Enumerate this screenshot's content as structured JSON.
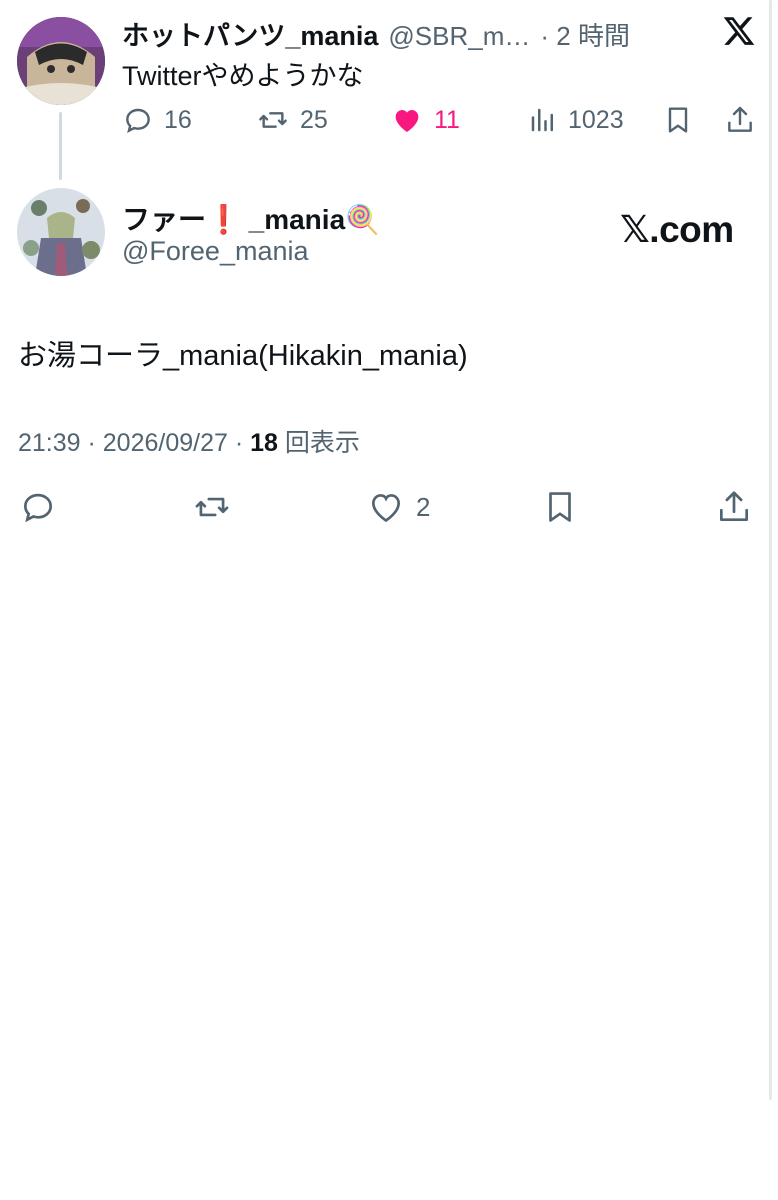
{
  "quoted_tweet": {
    "display_name": "ホットパンツ_mania",
    "handle": "@SBR_m…",
    "time": "· 2 時間",
    "text": "Twitterやめようかな",
    "stats": {
      "replies": "16",
      "retweets": "25",
      "likes": "11",
      "views": "1023"
    }
  },
  "main_tweet": {
    "display_name": "ファー❗ _mania🍭",
    "handle": "@Foree_mania",
    "brand": "𝕏.com",
    "text": "お湯コーラ_mania(Hikakin_mania)",
    "meta": {
      "time": "21:39 · 2026/09/27 · ",
      "views_count": "18",
      "views_label": " 回表示"
    },
    "stats": {
      "likes": "2"
    }
  },
  "colors": {
    "like_active": "#f91880",
    "muted": "#536471",
    "text": "#0f1419",
    "line": "#cfd9de"
  },
  "icons": [
    "x-logo-icon",
    "reply-icon",
    "retweet-icon",
    "heart-filled-icon",
    "views-icon",
    "bookmark-icon",
    "share-icon",
    "heart-outline-icon"
  ]
}
